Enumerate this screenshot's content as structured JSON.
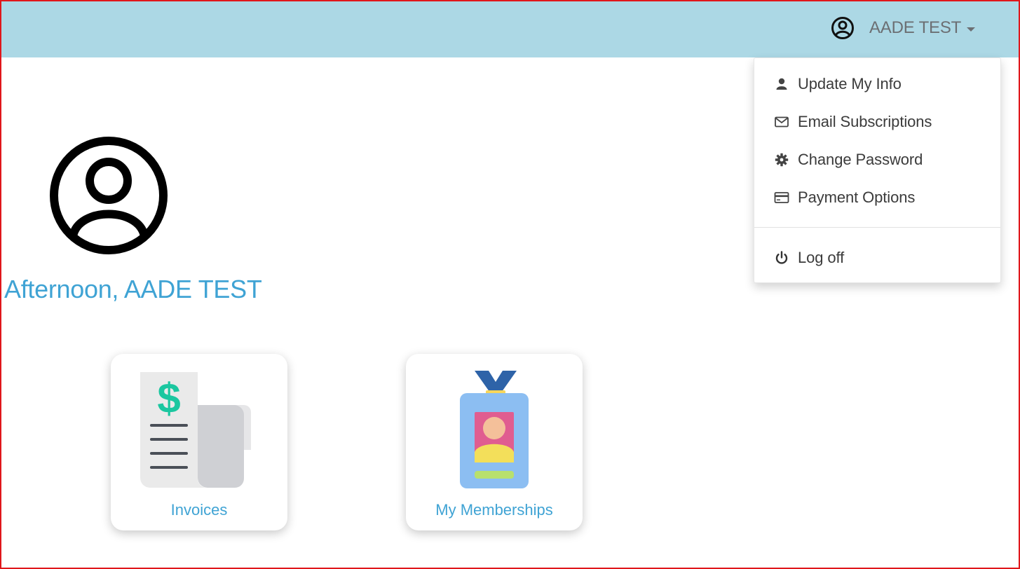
{
  "header": {
    "user_name": "AADE TEST",
    "icons": {
      "user": "user-circle-icon",
      "caret": "caret-down-icon"
    }
  },
  "user_menu": {
    "items": [
      {
        "label": "Update My Info",
        "icon": "user-icon"
      },
      {
        "label": "Email Subscriptions",
        "icon": "envelope-icon"
      },
      {
        "label": "Change Password",
        "icon": "gear-icon"
      },
      {
        "label": "Payment Options",
        "icon": "credit-card-icon"
      },
      {
        "label": "Log off",
        "icon": "power-icon"
      }
    ]
  },
  "main": {
    "greeting": "Afternoon, AADE TEST",
    "tiles": [
      {
        "label": "Invoices",
        "icon": "invoice-receipt-icon"
      },
      {
        "label": "My Memberships",
        "icon": "membership-badge-icon"
      }
    ]
  },
  "colors": {
    "topbar": "#acd8e5",
    "accent": "#3fa3d4",
    "frame_border": "#e0161b",
    "dollar_green": "#1bc7a0"
  }
}
